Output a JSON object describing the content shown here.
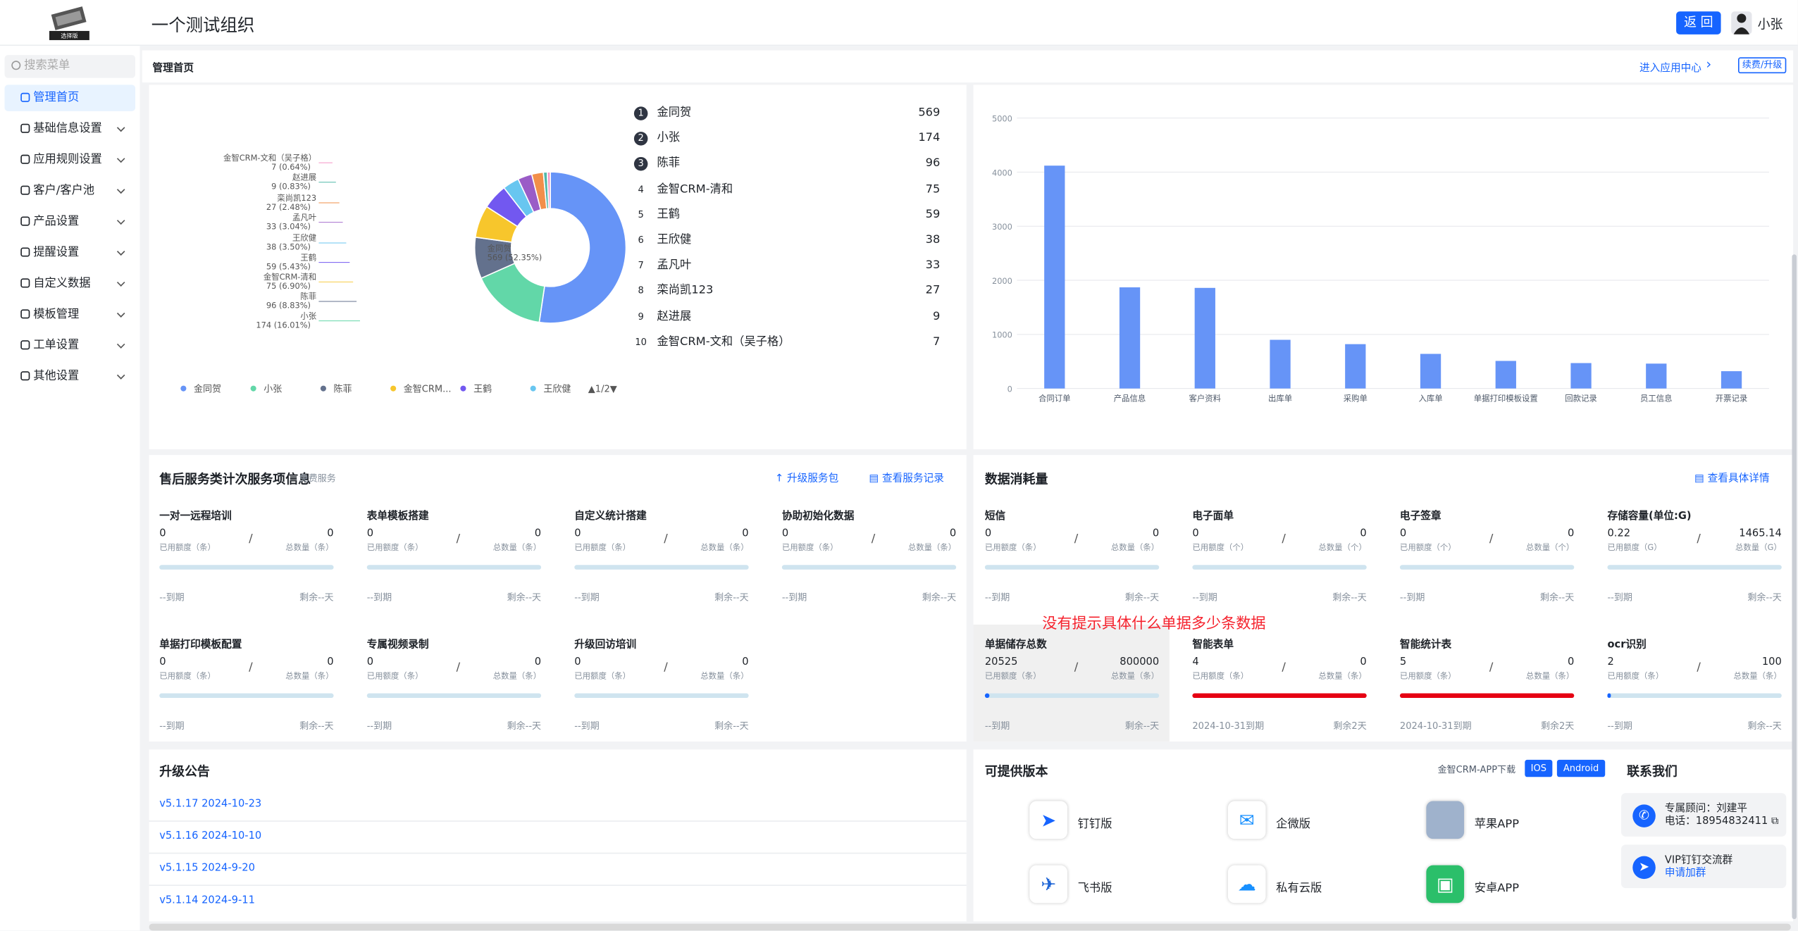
{
  "header": {
    "logo_text": "选择版",
    "org_name": "一个测试组织",
    "back_label": "返 回",
    "user_name": "小张"
  },
  "sidebar": {
    "search_placeholder": "搜索菜单",
    "items": [
      {
        "label": "管理首页",
        "icon": "home-icon"
      },
      {
        "label": "基础信息设置",
        "icon": "cube-icon"
      },
      {
        "label": "应用规则设置",
        "icon": "doc-icon"
      },
      {
        "label": "客户/客户池",
        "icon": "users-icon"
      },
      {
        "label": "产品设置",
        "icon": "box-icon"
      },
      {
        "label": "提醒设置",
        "icon": "bell-icon"
      },
      {
        "label": "自定义数据",
        "icon": "tools-icon"
      },
      {
        "label": "模板管理",
        "icon": "template-icon"
      },
      {
        "label": "工单设置",
        "icon": "ticket-icon"
      },
      {
        "label": "其他设置",
        "icon": "grid-icon"
      }
    ]
  },
  "page": {
    "title": "管理首页",
    "app_center": "进入应用中心",
    "renew": "续费/升级"
  },
  "pie": {
    "legend_page": "1/2",
    "chart_data": {
      "type": "pie",
      "slices": [
        {
          "name": "金同贺",
          "value": 569,
          "pct": "52.35%",
          "color": "#6694f7"
        },
        {
          "name": "小张",
          "value": 174,
          "pct": "16.01%",
          "color": "#62d7a8"
        },
        {
          "name": "陈菲",
          "value": 96,
          "pct": "8.83%",
          "color": "#63718d"
        },
        {
          "name": "金智CRM-清和",
          "value": 75,
          "pct": "6.90%",
          "color": "#f7c62c"
        },
        {
          "name": "王鹤",
          "value": 59,
          "pct": "5.43%",
          "color": "#7258f0"
        },
        {
          "name": "王欣健",
          "value": 38,
          "pct": "3.50%",
          "color": "#68c6f0"
        },
        {
          "name": "孟凡叶",
          "value": 33,
          "pct": "3.04%",
          "color": "#9a5cc7"
        },
        {
          "name": "栾尚凯123",
          "value": 27,
          "pct": "2.48%",
          "color": "#f28f4a"
        },
        {
          "name": "赵进展",
          "value": 9,
          "pct": "0.83%",
          "color": "#50b8a8"
        },
        {
          "name": "金智CRM-文和（吴子格）",
          "value": 7,
          "pct": "0.64%",
          "color": "#f595c6"
        }
      ]
    },
    "legend": [
      "金同贺",
      "小张",
      "陈菲",
      "金智CRM...",
      "王鹤",
      "王欣健"
    ]
  },
  "ranking": [
    {
      "rank": "1",
      "name": "金同贺",
      "value": "569"
    },
    {
      "rank": "2",
      "name": "小张",
      "value": "174"
    },
    {
      "rank": "3",
      "name": "陈菲",
      "value": "96"
    },
    {
      "rank": "4",
      "name": "金智CRM-清和",
      "value": "75"
    },
    {
      "rank": "5",
      "name": "王鹤",
      "value": "59"
    },
    {
      "rank": "6",
      "name": "王欣健",
      "value": "38"
    },
    {
      "rank": "7",
      "name": "孟凡叶",
      "value": "33"
    },
    {
      "rank": "8",
      "name": "栾尚凯123",
      "value": "27"
    },
    {
      "rank": "9",
      "name": "赵进展",
      "value": "9"
    },
    {
      "rank": "10",
      "name": "金智CRM-文和（吴子格）",
      "value": "7"
    }
  ],
  "bar": {
    "chart_data": {
      "type": "bar",
      "categories": [
        "合同订单",
        "产品信息",
        "客户资料",
        "出库单",
        "采购单",
        "入库单",
        "单据打印模板设置",
        "回款记录",
        "员工信息",
        "开票记录"
      ],
      "values": [
        4120,
        1870,
        1860,
        900,
        820,
        640,
        510,
        470,
        460,
        320
      ],
      "yticks": [
        "0",
        "1000",
        "2000",
        "3000",
        "4000",
        "5000"
      ],
      "ylim": [
        0,
        5000
      ],
      "color": "#6694f7"
    }
  },
  "service": {
    "title": "售后服务类计次服务项信息",
    "badge": "免费服务",
    "upgrade": "升级服务包",
    "records": "查看服务记录",
    "items": [
      {
        "title": "一对一远程培训",
        "used": "0",
        "total": "0",
        "expire": "--到期",
        "remain": "剩余--天"
      },
      {
        "title": "表单模板搭建",
        "used": "0",
        "total": "0",
        "expire": "--到期",
        "remain": "剩余--天"
      },
      {
        "title": "自定义统计搭建",
        "used": "0",
        "total": "0",
        "expire": "--到期",
        "remain": "剩余--天"
      },
      {
        "title": "协助初始化数据",
        "used": "0",
        "total": "0",
        "expire": "--到期",
        "remain": "剩余--天"
      },
      {
        "title": "单据打印模板配置",
        "used": "0",
        "total": "0",
        "expire": "--到期",
        "remain": "剩余--天"
      },
      {
        "title": "专属视频录制",
        "used": "0",
        "total": "0",
        "expire": "--到期",
        "remain": "剩余--天"
      },
      {
        "title": "升级回访培训",
        "used": "0",
        "total": "0",
        "expire": "--到期",
        "remain": "剩余--天"
      }
    ],
    "used_label": "已用额度（条）",
    "total_label": "总数量（条）"
  },
  "consumption": {
    "title": "数据消耗量",
    "detail": "查看具体详情",
    "items": [
      {
        "title": "短信",
        "used": "0",
        "total": "0",
        "used_label": "已用额度（条）",
        "total_label": "总数量（条）",
        "expire": "--到期",
        "remain": "剩余--天",
        "level": 0,
        "color": "#1664ff"
      },
      {
        "title": "电子面单",
        "used": "0",
        "total": "0",
        "used_label": "已用额度（个）",
        "total_label": "总数量（个）",
        "expire": "--到期",
        "remain": "剩余--天",
        "level": 0,
        "color": "#1664ff"
      },
      {
        "title": "电子签章",
        "used": "0",
        "total": "0",
        "used_label": "已用额度（个）",
        "total_label": "总数量（个）",
        "expire": "--到期",
        "remain": "剩余--天",
        "level": 0,
        "color": "#1664ff"
      },
      {
        "title": "存储容量(单位:G)",
        "used": "0.22",
        "total": "1465.14",
        "used_label": "已用额度（G）",
        "total_label": "总数量（G）",
        "expire": "--到期",
        "remain": "剩余--天",
        "level": 0,
        "color": "#1664ff"
      },
      {
        "title": "单据储存总数",
        "used": "20525",
        "total": "800000",
        "used_label": "已用额度（条）",
        "total_label": "总数量（条）",
        "expire": "--到期",
        "remain": "剩余--天",
        "level": 0.026,
        "color": "#1664ff"
      },
      {
        "title": "智能表单",
        "used": "4",
        "total": "0",
        "used_label": "已用额度（条）",
        "total_label": "总数量（条）",
        "expire": "2024-10-31到期",
        "remain": "剩余2天",
        "level": 1,
        "color": "#e60012"
      },
      {
        "title": "智能统计表",
        "used": "5",
        "total": "0",
        "used_label": "已用额度（条）",
        "total_label": "总数量（条）",
        "expire": "2024-10-31到期",
        "remain": "剩余2天",
        "level": 1,
        "color": "#e60012"
      },
      {
        "title": "ocr识别",
        "used": "2",
        "total": "100",
        "used_label": "已用额度（条）",
        "total_label": "总数量（条）",
        "expire": "--到期",
        "remain": "剩余--天",
        "level": 0.02,
        "color": "#1664ff"
      }
    ]
  },
  "annotation": "没有提示具体什么单据多少条数据",
  "notices": {
    "title": "升级公告",
    "items": [
      "v5.1.17 2024-10-23",
      "v5.1.16 2024-10-10",
      "v5.1.15 2024-9-20",
      "v5.1.14 2024-9-11"
    ]
  },
  "versions": {
    "title": "可提供版本",
    "download": "金智CRM-APP下载",
    "ios": "IOS",
    "android": "Android",
    "items": [
      "钉钉版",
      "企微版",
      "苹果APP",
      "飞书版",
      "私有云版",
      "安卓APP"
    ]
  },
  "contact": {
    "title": "联系我们",
    "consultant": "专属顾问：刘建平",
    "phone": "电话：18954832411",
    "group": "VIP钉钉交流群",
    "join": "申请加群"
  }
}
